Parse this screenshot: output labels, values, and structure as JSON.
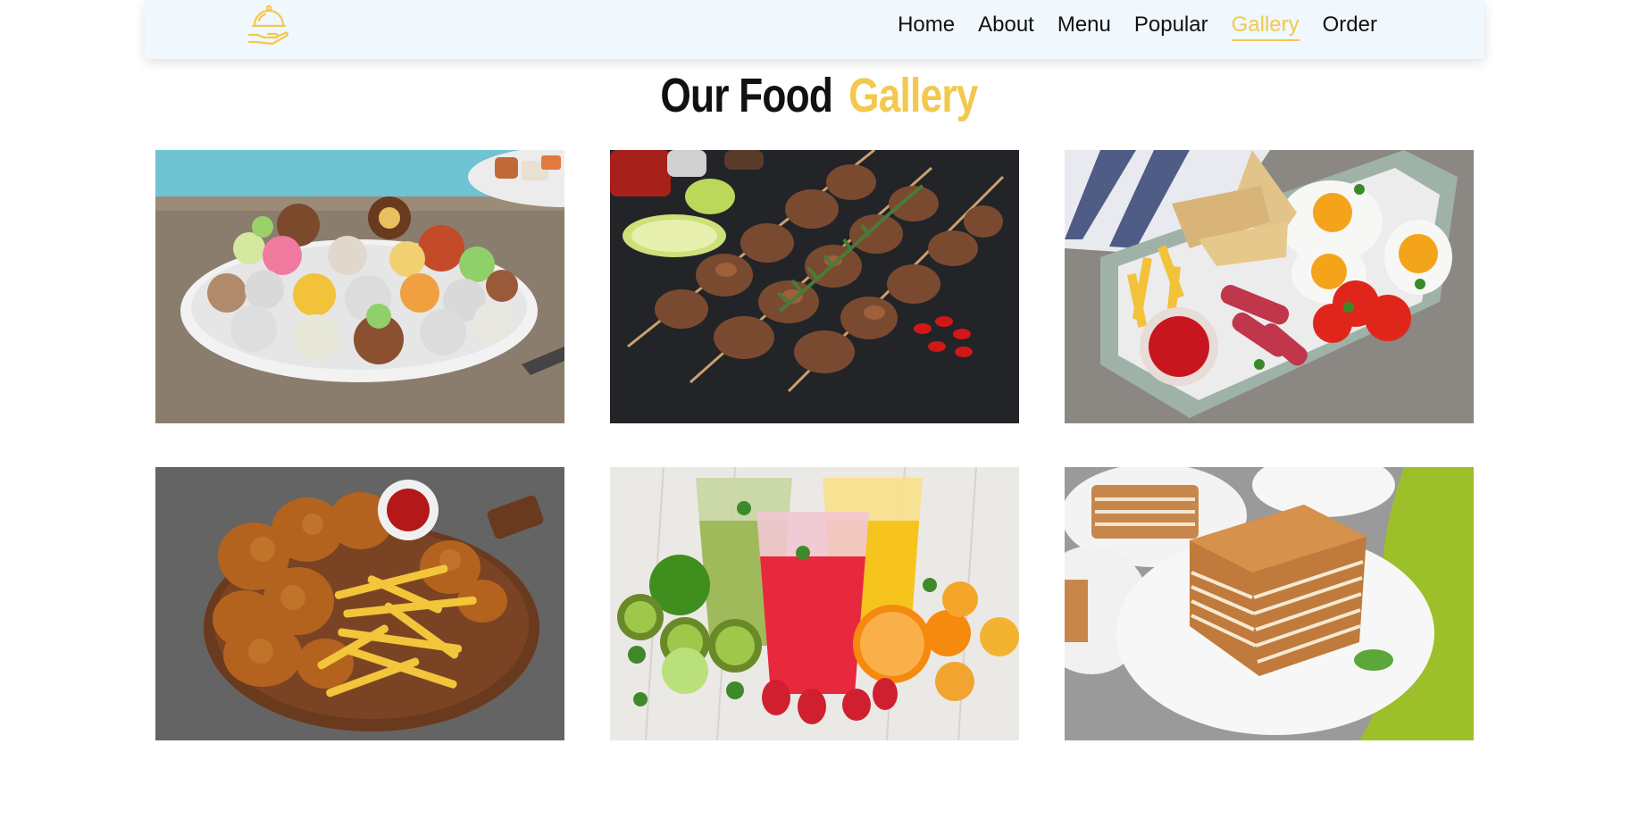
{
  "nav": {
    "logo_icon": "cloche-serving-icon",
    "items": [
      {
        "label": "Home",
        "active": false
      },
      {
        "label": "About",
        "active": false
      },
      {
        "label": "Menu",
        "active": false
      },
      {
        "label": "Popular",
        "active": false
      },
      {
        "label": "Gallery",
        "active": true
      },
      {
        "label": "Order",
        "active": false
      }
    ],
    "accent_color": "#f2c94c"
  },
  "gallery": {
    "heading_first": "Our Food",
    "heading_second": "Gallery",
    "images": [
      {
        "subject": "sweets-platter-photo"
      },
      {
        "subject": "grilled-skewers-photo"
      },
      {
        "subject": "breakfast-plate-photo"
      },
      {
        "subject": "fried-chicken-fries-photo"
      },
      {
        "subject": "fruit-smoothies-photo"
      },
      {
        "subject": "layer-cake-photo"
      }
    ]
  }
}
